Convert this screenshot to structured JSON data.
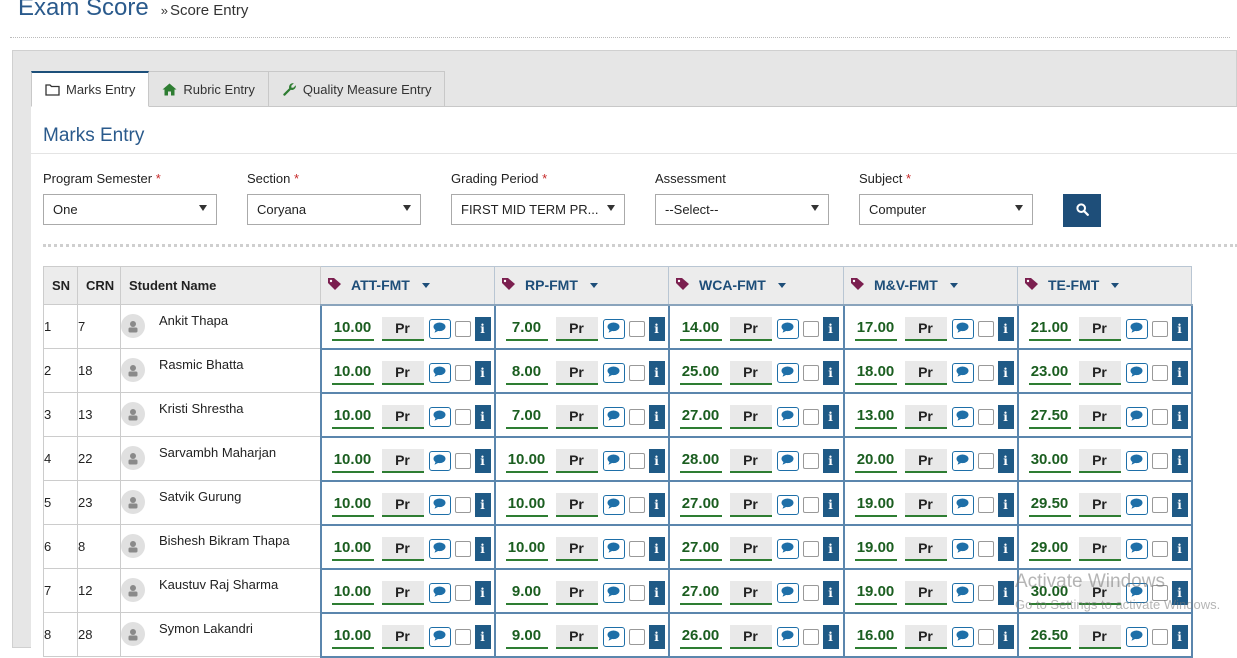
{
  "page": {
    "title": "Exam Score",
    "breadcrumb_sep": "»",
    "breadcrumb": "Score Entry"
  },
  "tabs": [
    {
      "label": "Marks Entry",
      "icon": "folder-icon",
      "active": true
    },
    {
      "label": "Rubric Entry",
      "icon": "home-icon"
    },
    {
      "label": "Quality Measure Entry",
      "icon": "wrench-icon"
    }
  ],
  "section_title": "Marks Entry",
  "filters": [
    {
      "label": "Program Semester",
      "required": true,
      "value": "One"
    },
    {
      "label": "Section",
      "required": true,
      "value": "Coryana"
    },
    {
      "label": "Grading Period",
      "required": true,
      "value": "FIRST MID TERM PR..."
    },
    {
      "label": "Assessment",
      "required": false,
      "value": "--Select--"
    },
    {
      "label": "Subject",
      "required": true,
      "value": "Computer"
    }
  ],
  "search_icon": "search-icon",
  "table": {
    "headers": {
      "sn": "SN",
      "crn": "CRN",
      "name": "Student Name"
    },
    "components": [
      "ATT-FMT",
      "RP-FMT",
      "WCA-FMT",
      "M&V-FMT",
      "TE-FMT"
    ],
    "attendance_label": "Pr",
    "info_label": "i",
    "rows": [
      {
        "sn": "1",
        "crn": "7",
        "name": "Ankit Thapa",
        "marks": [
          "10.00",
          "7.00",
          "14.00",
          "17.00",
          "21.00"
        ]
      },
      {
        "sn": "2",
        "crn": "18",
        "name": "Rasmic Bhatta",
        "marks": [
          "10.00",
          "8.00",
          "25.00",
          "18.00",
          "23.00"
        ]
      },
      {
        "sn": "3",
        "crn": "13",
        "name": "Kristi Shrestha",
        "marks": [
          "10.00",
          "7.00",
          "27.00",
          "13.00",
          "27.50"
        ]
      },
      {
        "sn": "4",
        "crn": "22",
        "name": "Sarvambh Maharjan",
        "marks": [
          "10.00",
          "10.00",
          "28.00",
          "20.00",
          "30.00"
        ]
      },
      {
        "sn": "5",
        "crn": "23",
        "name": "Satvik Gurung",
        "marks": [
          "10.00",
          "10.00",
          "27.00",
          "19.00",
          "29.50"
        ]
      },
      {
        "sn": "6",
        "crn": "8",
        "name": "Bishesh Bikram Thapa",
        "marks": [
          "10.00",
          "10.00",
          "27.00",
          "19.00",
          "29.00"
        ]
      },
      {
        "sn": "7",
        "crn": "12",
        "name": "Kaustuv Raj Sharma",
        "marks": [
          "10.00",
          "9.00",
          "27.00",
          "19.00",
          "30.00"
        ]
      },
      {
        "sn": "8",
        "crn": "28",
        "name": "Symon Lakandri",
        "marks": [
          "10.00",
          "9.00",
          "26.00",
          "16.00",
          "26.50"
        ]
      }
    ]
  },
  "watermark": {
    "line1": "Activate Windows",
    "line2": "Go to Settings to activate Windows."
  },
  "colors": {
    "primary": "#1e4e79",
    "mark_green": "#1b5e20",
    "tag_purple": "#7b1f4f",
    "required": "#c62828"
  }
}
